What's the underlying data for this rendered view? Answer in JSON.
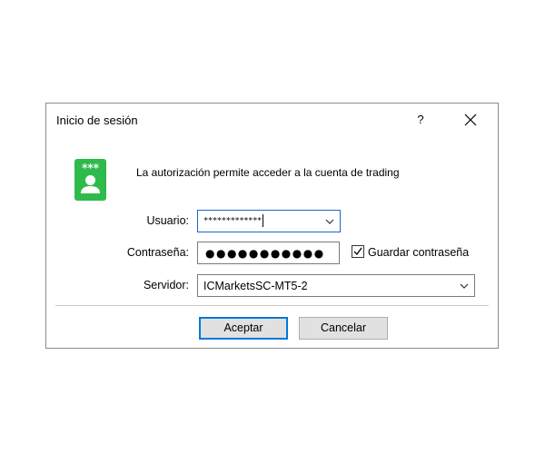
{
  "dialog": {
    "title": "Inicio de sesión",
    "help_label": "?",
    "intro_text": "La autorización permite acceder a la cuenta de trading"
  },
  "app_icon": {
    "name": "user-key-icon",
    "stars_text": "***",
    "color": "#2fba4b"
  },
  "form": {
    "user_label": "Usuario:",
    "user_value": "*************",
    "password_label": "Contraseña:",
    "password_value": "●●●●●●●●●●●",
    "save_password_label": "Guardar contraseña",
    "save_password_checked": true,
    "server_label": "Servidor:",
    "server_value": "ICMarketsSC-MT5-2"
  },
  "buttons": {
    "ok_label": "Aceptar",
    "cancel_label": "Cancelar"
  },
  "colors": {
    "focus_border": "#1f64c8",
    "default_button_border": "#0078d7",
    "button_face": "#e1e1e1"
  }
}
